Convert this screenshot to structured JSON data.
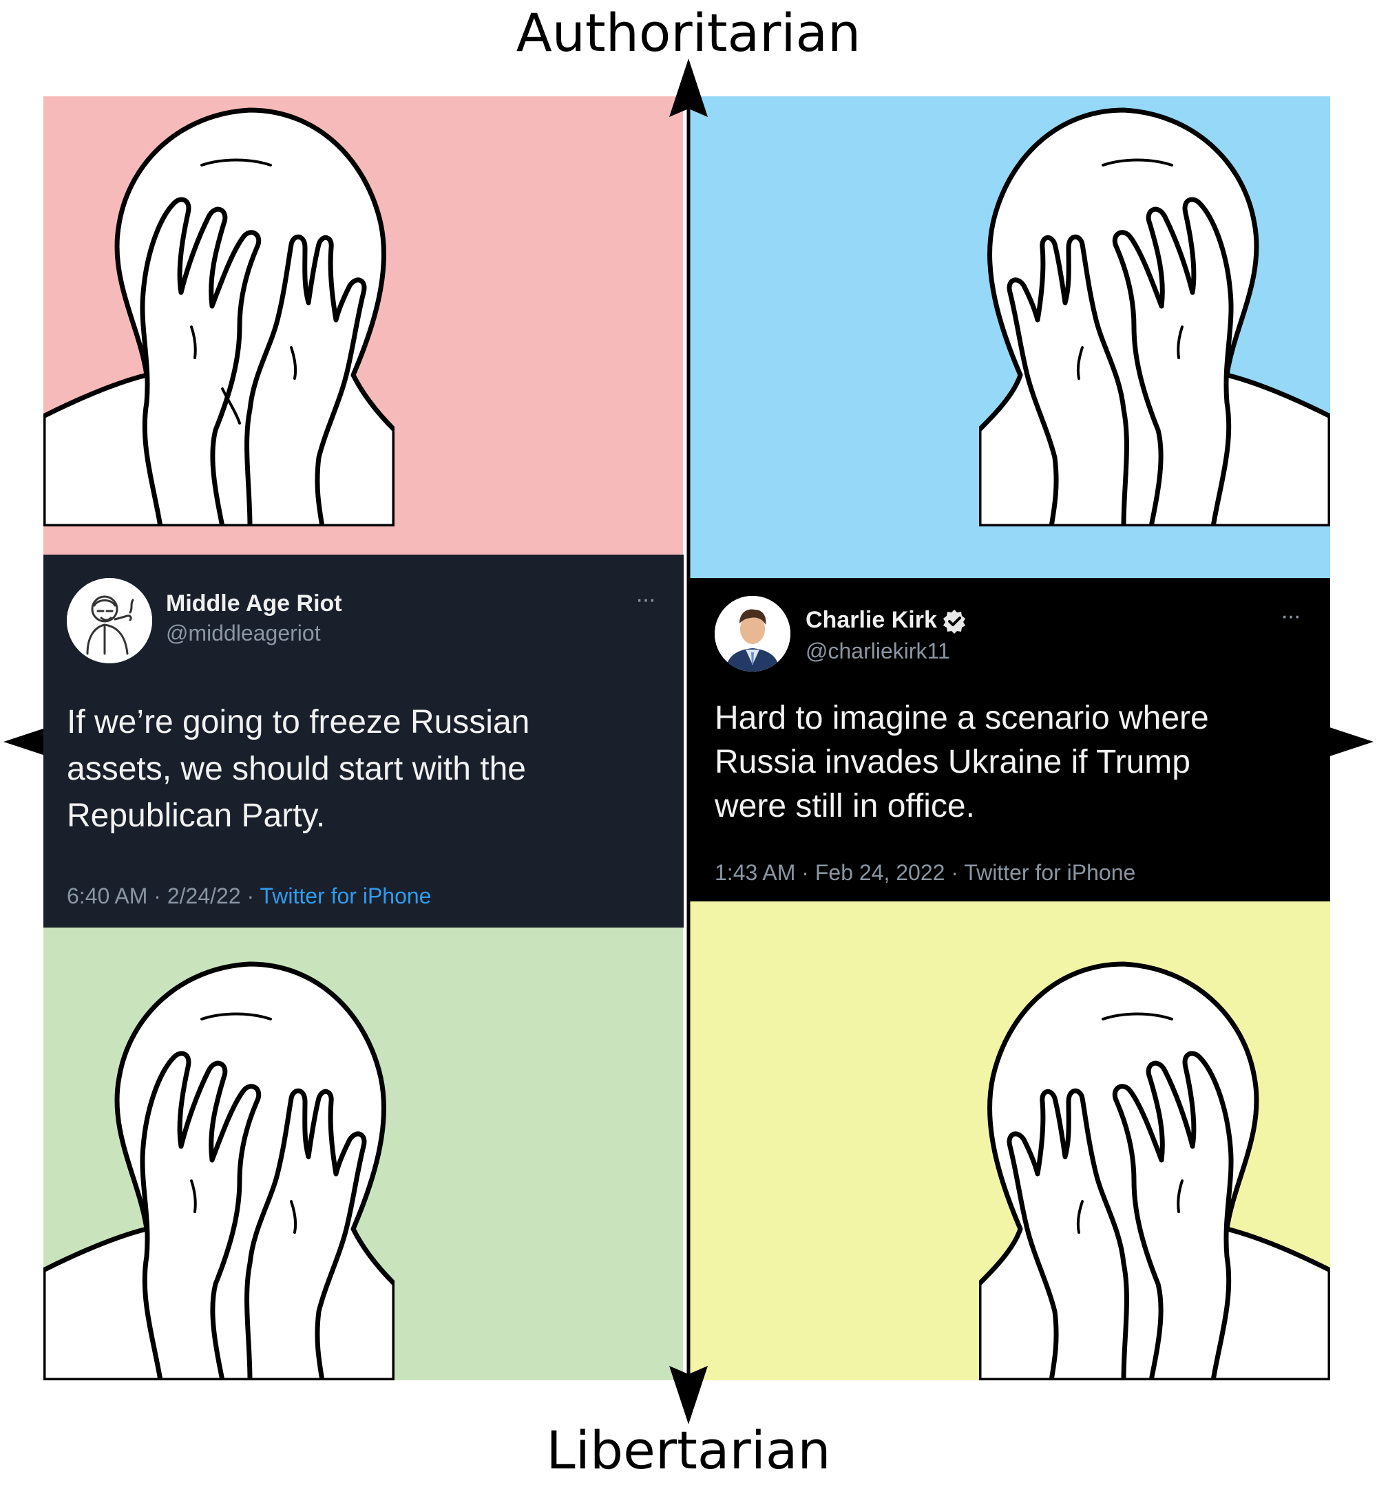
{
  "axes": {
    "top_label": "Authoritarian",
    "bottom_label": "Libertarian"
  },
  "colors": {
    "top_left": "#f7babb",
    "top_right": "#95d8f7",
    "bottom_left": "#c9e4bd",
    "bottom_right": "#f3f5a6"
  },
  "tweets": {
    "left": {
      "name": "Middle Age Riot",
      "handle": "@middleageriot",
      "more": "···",
      "text": "If we’re going to freeze Russian\nassets, we should start with the\nRepublican Party.",
      "time": "6:40 AM · 2/24/22 · ",
      "source": "Twitter for iPhone"
    },
    "right": {
      "name": "Charlie Kirk",
      "handle": "@charliekirk11",
      "more": "···",
      "text": "Hard to imagine a scenario where\nRussia invades Ukraine if Trump\nwere still in office.",
      "time": "1:43 AM · Feb 24, 2022 · Twitter for iPhone"
    }
  },
  "icons": {
    "face": "facepalm-wojak-icon",
    "verified": "verified-badge-icon"
  }
}
